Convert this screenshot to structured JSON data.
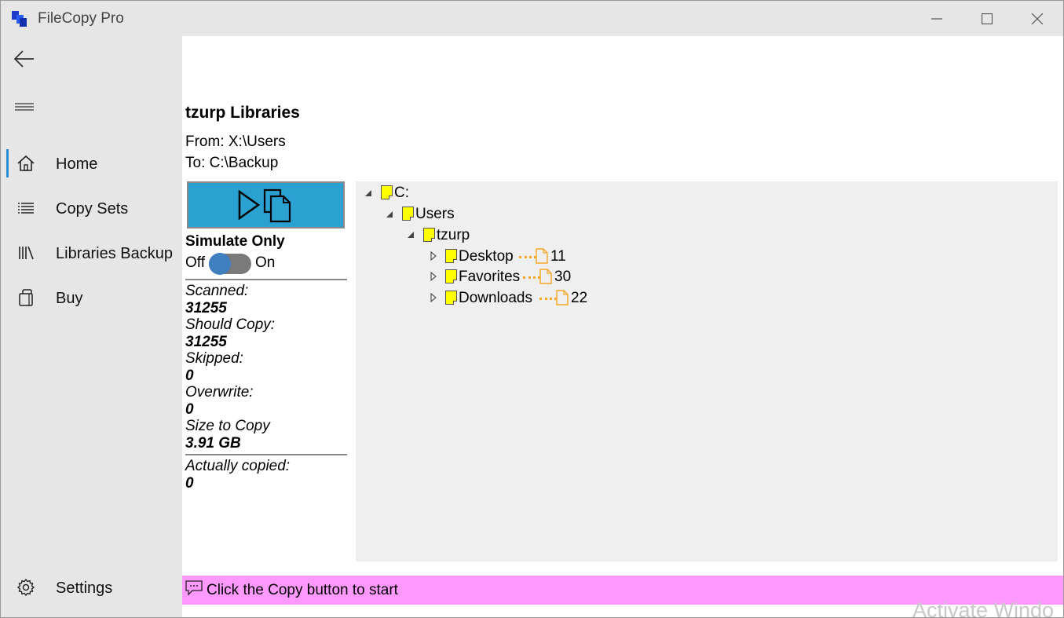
{
  "window": {
    "title": "FileCopy Pro"
  },
  "sidebar": {
    "items": [
      {
        "label": "Home",
        "icon": "home-icon"
      },
      {
        "label": "Copy Sets",
        "icon": "list-icon"
      },
      {
        "label": "Libraries Backup",
        "icon": "library-icon"
      },
      {
        "label": "Buy",
        "icon": "shopping-bag-icon"
      }
    ],
    "settings_label": "Settings",
    "selected": "Home"
  },
  "main": {
    "title": "tzurp Libraries",
    "from": "From:  X:\\Users",
    "to": "To: C:\\Backup",
    "simulate_label": "Simulate Only",
    "toggle_off": "Off",
    "toggle_on": "On",
    "toggle_state": "off",
    "stats": [
      {
        "label": "Scanned:",
        "value": "31255"
      },
      {
        "label": "Should Copy:",
        "value": "31255"
      },
      {
        "label": "Skipped:",
        "value": "0"
      },
      {
        "label": "Overwrite:",
        "value": "0"
      },
      {
        "label": "Size to Copy",
        "value": "3.91 GB"
      },
      {
        "label": "Actually copied:",
        "value": "0"
      }
    ]
  },
  "tree": {
    "root": "C:",
    "level1": "Users",
    "level2": "tzurp",
    "children": [
      {
        "name": "Desktop",
        "count": "11"
      },
      {
        "name": "Favorites",
        "count": "30"
      },
      {
        "name": "Downloads",
        "count": "22"
      }
    ]
  },
  "status": {
    "message": "Click the Copy button to start"
  },
  "watermark": "Activate Windo",
  "colors": {
    "accent": "#2ba1d1",
    "status_bg": "#ff99ff",
    "folder": "#ffff00",
    "file_outline": "#f5a623",
    "selection": "#2a8fd0"
  }
}
